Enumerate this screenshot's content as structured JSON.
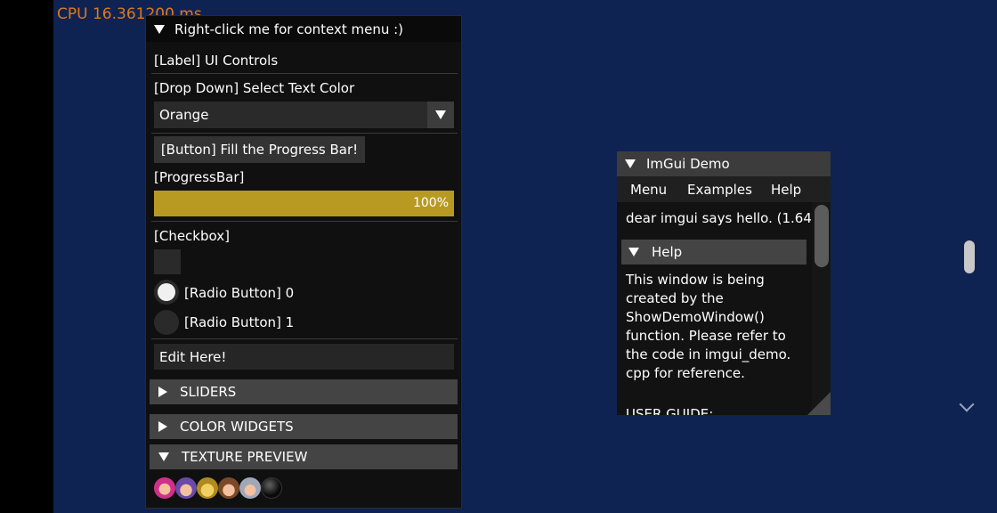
{
  "overlay": {
    "cpu_text": "CPU 16.361200 ms"
  },
  "main_window": {
    "title": "Right-click me for context menu :)",
    "label_text": "[Label] UI Controls",
    "dropdown_label": "[Drop Down] Select Text Color",
    "dropdown_value": "Orange",
    "button_label": "[Button] Fill the Progress Bar!",
    "progress_label": "[ProgressBar]",
    "progress": {
      "value": 1.0,
      "text": "100%",
      "color": "#b89a22"
    },
    "checkbox_label": "[Checkbox]",
    "checkbox_checked": false,
    "radios": [
      {
        "label": "[Radio Button] 0",
        "selected": true
      },
      {
        "label": "[Radio Button] 1",
        "selected": false
      }
    ],
    "text_input_value": "Edit Here!",
    "headers": [
      {
        "label": "SLIDERS",
        "expanded": false
      },
      {
        "label": "COLOR WIDGETS",
        "expanded": false
      },
      {
        "label": "TEXTURE PREVIEW",
        "expanded": true
      }
    ],
    "texture_icons": [
      "pink-character-icon",
      "purple-character-icon",
      "yellow-character-icon",
      "brown-character-icon",
      "astronaut-character-icon",
      "black-orb-icon"
    ]
  },
  "demo_window": {
    "title": "ImGui Demo",
    "menu": [
      "Menu",
      "Examples",
      "Help"
    ],
    "hello_text": "dear imgui says hello. (1.64",
    "help_header": "Help",
    "help_lines": [
      "This window is being",
      "created by the",
      "ShowDemoWindow()",
      "function. Please refer to",
      "the code in imgui_demo.",
      "cpp for reference."
    ],
    "user_guide": "USER GUIDE:"
  },
  "colors": {
    "background": "#0f2352",
    "cpu_text": "#e07818"
  }
}
